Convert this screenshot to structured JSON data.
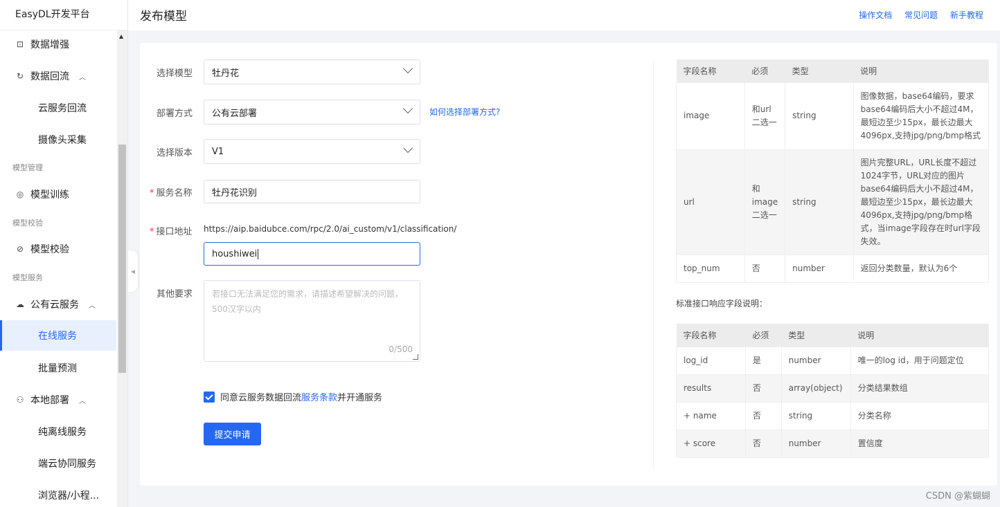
{
  "brand": "EasyDL开发平台",
  "header": {
    "title": "发布模型",
    "links": [
      "操作文档",
      "常见问题",
      "新手教程"
    ]
  },
  "sidebar": {
    "items": [
      {
        "label": "数据增强",
        "icon": "data-augment-icon"
      },
      {
        "label": "数据回流",
        "icon": "refresh-icon",
        "expanded": true
      },
      {
        "label": "云服务回流"
      },
      {
        "label": "摄像头采集"
      },
      {
        "label": "模型训练",
        "icon": "model-train-icon"
      },
      {
        "label": "模型校验",
        "icon": "check-circle-icon"
      },
      {
        "label": "公有云服务",
        "icon": "cloud-icon",
        "expanded": true
      },
      {
        "label": "在线服务",
        "active": true
      },
      {
        "label": "批量预测"
      },
      {
        "label": "本地部署",
        "icon": "local-deploy-icon",
        "expanded": true
      },
      {
        "label": "纯离线服务"
      },
      {
        "label": "端云协同服务"
      },
      {
        "label": "浏览器/小程..."
      }
    ],
    "groups": [
      "模型管理",
      "模型校验",
      "模型服务"
    ]
  },
  "form": {
    "model": {
      "label": "选择模型",
      "value": "牡丹花"
    },
    "deploy": {
      "label": "部署方式",
      "value": "公有云部署",
      "help": "如何选择部署方式?"
    },
    "version": {
      "label": "选择版本",
      "value": "V1"
    },
    "service_name": {
      "label": "服务名称",
      "value": "牡丹花识别"
    },
    "endpoint": {
      "label": "接口地址",
      "prefix": "https://aip.baidubce.com/rpc/2.0/ai_custom/v1/classification/",
      "value": "houshiwei"
    },
    "other": {
      "label": "其他要求",
      "placeholder": "若接口无法满足您的需求，请描述希望解决的问题，500汉字以内",
      "counter": "0/500"
    },
    "agree": {
      "before": "同意云服务数据回流",
      "link": "服务条款",
      "after": "并开通服务"
    },
    "submit": "提交申请"
  },
  "request_table": {
    "headers": [
      "字段名称",
      "必须",
      "类型",
      "说明"
    ],
    "rows": [
      [
        "image",
        "和url二选一",
        "string",
        "图像数据，base64编码，要求base64编码后大小不超过4M，最短边至少15px，最长边最大4096px,支持jpg/png/bmp格式"
      ],
      [
        "url",
        "和image二选一",
        "string",
        "图片完整URL，URL长度不超过1024字节，URL对应的图片base64编码后大小不超过4M，最短边至少15px，最长边最大4096px,支持jpg/png/bmp格式，当image字段存在时url字段失效。"
      ],
      [
        "top_num",
        "否",
        "number",
        "返回分类数量，默认为6个"
      ]
    ]
  },
  "response_title": "标准接口响应字段说明：",
  "response_table": {
    "headers": [
      "字段名称",
      "必须",
      "类型",
      "说明"
    ],
    "rows": [
      [
        "log_id",
        "是",
        "number",
        "唯一的log id，用于问题定位"
      ],
      [
        "results",
        "否",
        "array(object)",
        "分类结果数组"
      ],
      [
        "+ name",
        "否",
        "string",
        "分类名称"
      ],
      [
        "+ score",
        "否",
        "number",
        "置信度"
      ]
    ]
  },
  "watermark": "CSDN @紫蝴蝴"
}
